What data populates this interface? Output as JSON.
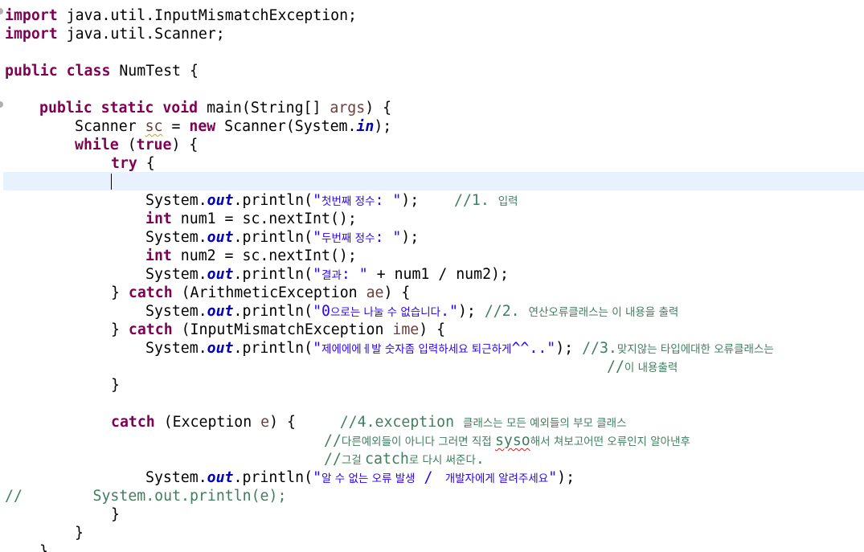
{
  "code": {
    "import1": {
      "kw": "import",
      "rest": " java.util.InputMismatchException;"
    },
    "import2": {
      "kw": "import",
      "rest": " java.util.Scanner;"
    },
    "class_decl": {
      "kw1": "public",
      "kw2": "class",
      "rest": " NumTest {"
    },
    "main_decl": {
      "kw1": "public",
      "kw2": "static",
      "kw3": "void",
      "mid": " main(String[] ",
      "param": "args",
      "end": ") {"
    },
    "scanner_line": {
      "pre": "Scanner ",
      "var": "sc",
      "eq": " = ",
      "kw": "new",
      "mid": " Scanner(System.",
      "field": "in",
      "end": ");"
    },
    "while_line": {
      "kw1": "while",
      "mid": " (",
      "kw2": "true",
      "end": ") {"
    },
    "try_line": {
      "kw": "try",
      "end": " {"
    },
    "print1": {
      "pre": "System.",
      "field": "out",
      "mid": ".println(",
      "q1": "\"",
      "ko": "첫번째 정수",
      "q2": ": \"",
      "end": ");",
      "gap": "    ",
      "c1": "//1. ",
      "c2": "입력"
    },
    "int1": {
      "kw": "int",
      "rest": " num1 = sc.nextInt();"
    },
    "print2": {
      "pre": "System.",
      "field": "out",
      "mid": ".println(",
      "q1": "\"",
      "ko": "두번째 정수",
      "q2": ": \"",
      "end": ");"
    },
    "int2": {
      "kw": "int",
      "rest": " num2 = sc.nextInt();"
    },
    "print3": {
      "pre": "System.",
      "field": "out",
      "mid": ".println(",
      "q1": "\"",
      "ko": "결과",
      "q2": ": \"",
      "end": " + num1 / num2);"
    },
    "catch1": {
      "pre": "} ",
      "kw": "catch",
      "mid": " (ArithmeticException ",
      "var": "ae",
      "end": ") {"
    },
    "print4": {
      "pre": "System.",
      "field": "out",
      "mid": ".println(",
      "s1": "\"0",
      "ko": "으로는 나눌 수 없습니다",
      "s2": ".\"",
      "end": "); ",
      "c1": "//2. ",
      "c2": "연산오류클래스는 이 내용을 출력"
    },
    "catch2": {
      "pre": "} ",
      "kw": "catch",
      "mid": " (InputMismatchException ",
      "var": "ime",
      "end": ") {"
    },
    "print5": {
      "pre": "System.",
      "field": "out",
      "mid": ".println(",
      "s1": "\"",
      "ko": "제에에에ㅔ발 숫자좀 입력하세요 퇴근하게",
      "s2": "^^..\"",
      "end": "); ",
      "c1": "//3.",
      "c2": "맞지않는 타입에대한 오류클래스는"
    },
    "comment5b": {
      "c1": "//",
      "c2": "이 내용출력"
    },
    "close1": "}",
    "catch3": {
      "kw": "catch",
      "mid": " (Exception ",
      "var": "e",
      "end": ") {",
      "gap": "     ",
      "c1": "//4.exception ",
      "c2": "클래스는 모든 예외들의 부모 클래스"
    },
    "comment6b": {
      "c1": "//",
      "c2a": "다른예외들이 아니다 그러면 직접 ",
      "spell": "syso",
      "c2b": "해서 쳐보고어떤 오류인지 알아낸후"
    },
    "comment6c": {
      "c1": "//",
      "c2a": "그걸 ",
      "c3": "catch",
      "c2b": "로 다시 써준다",
      "c4": "."
    },
    "print6": {
      "pre": "System.",
      "field": "out",
      "mid": ".println(",
      "q1": "\"",
      "ko": "알 수 없는 오류 발생",
      "s2": " / ",
      "ko2": " 개발자에게 알려주세요",
      "q2": "\"",
      "end": ");"
    },
    "commented": {
      "slashes": "//",
      "gap": "        ",
      "rest": "System.out.println(e);"
    },
    "close2": "}",
    "close3": "}",
    "close4": "}"
  },
  "colors": {
    "keyword": "#7f0055",
    "string": "#2a00ff",
    "static_field": "#0000c0",
    "comment": "#3f7f5f",
    "local_variable": "#6a3e3e",
    "current_line": "#e8f2fe"
  }
}
